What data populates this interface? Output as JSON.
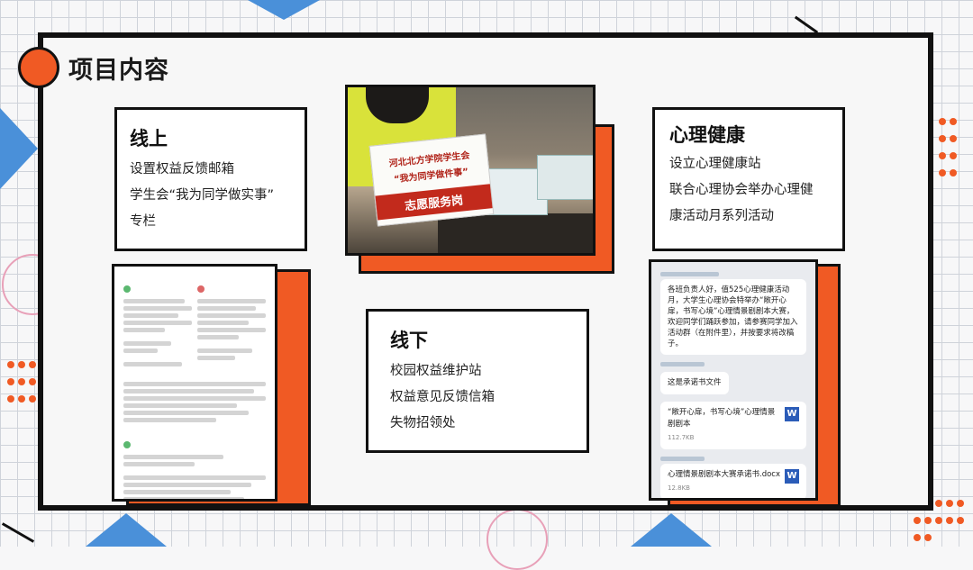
{
  "title": "项目内容",
  "online": {
    "heading": "线上",
    "lines": [
      "设置权益反馈邮箱",
      "学生会“我为同学做实事”",
      "专栏"
    ]
  },
  "offline": {
    "heading": "线下",
    "lines": [
      "校园权益维护站",
      "权益意见反馈信箱",
      "失物招领处"
    ]
  },
  "mental": {
    "heading": "心理健康",
    "lines": [
      "设立心理健康站",
      "联合心理协会举办心理健",
      "康活动月系列活动"
    ]
  },
  "photo": {
    "sign_line1": "河北北方学院学生会",
    "sign_line2": "“我为同学做件事”",
    "sign_banner": "志愿服务岗"
  },
  "chat": {
    "message1": "各班负责人好，值525心理健康活动月，大学生心理协会特举办“敞开心扉，书写心境”心理情景剧剧本大赛，欢迎同学们踊跃参加，请参赛同学加入活动群（在附件里），并按要求将改稿子。",
    "message2": "这是承诺书文件",
    "file1_name": "“敞开心扉，书写心境”心理情景剧剧本",
    "file1_size": "112.7KB",
    "file2_name": "心理情景剧剧本大赛承诺书.docx",
    "file2_size": "12.8KB",
    "word_icon": "W"
  },
  "colors": {
    "accent": "#f05a24",
    "blue": "#4a90d9",
    "frame": "#111111"
  }
}
